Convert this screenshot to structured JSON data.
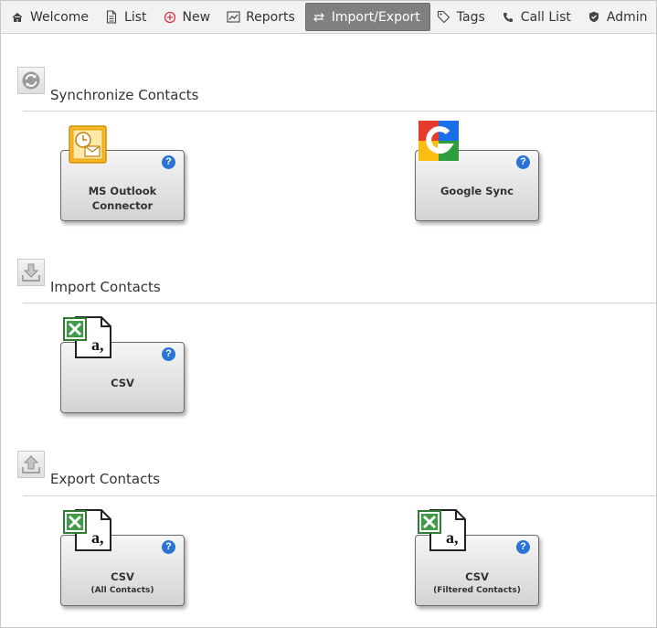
{
  "nav": {
    "items": [
      {
        "label": "Welcome"
      },
      {
        "label": "List"
      },
      {
        "label": "New"
      },
      {
        "label": "Reports"
      },
      {
        "label": "Import/Export"
      },
      {
        "label": "Tags"
      },
      {
        "label": "Call List"
      },
      {
        "label": "Admin"
      }
    ],
    "active": "Import/Export",
    "active_color": "#808080"
  },
  "sections": {
    "sync": {
      "title": "Synchronize Contacts",
      "cards": {
        "outlook": {
          "label_line1": "MS Outlook",
          "label_line2": "Connector"
        },
        "google": {
          "label": "Google Sync"
        }
      }
    },
    "import": {
      "title": "Import Contacts",
      "cards": {
        "csv": {
          "label": "CSV"
        }
      }
    },
    "export": {
      "title": "Export Contacts",
      "cards": {
        "csv_all": {
          "label": "CSV",
          "sublabel": "(All Contacts)"
        },
        "csv_filtered": {
          "label": "CSV",
          "sublabel": "(Filtered Contacts)"
        }
      }
    }
  },
  "help_glyph": "?",
  "help_color": "#2a74d8"
}
